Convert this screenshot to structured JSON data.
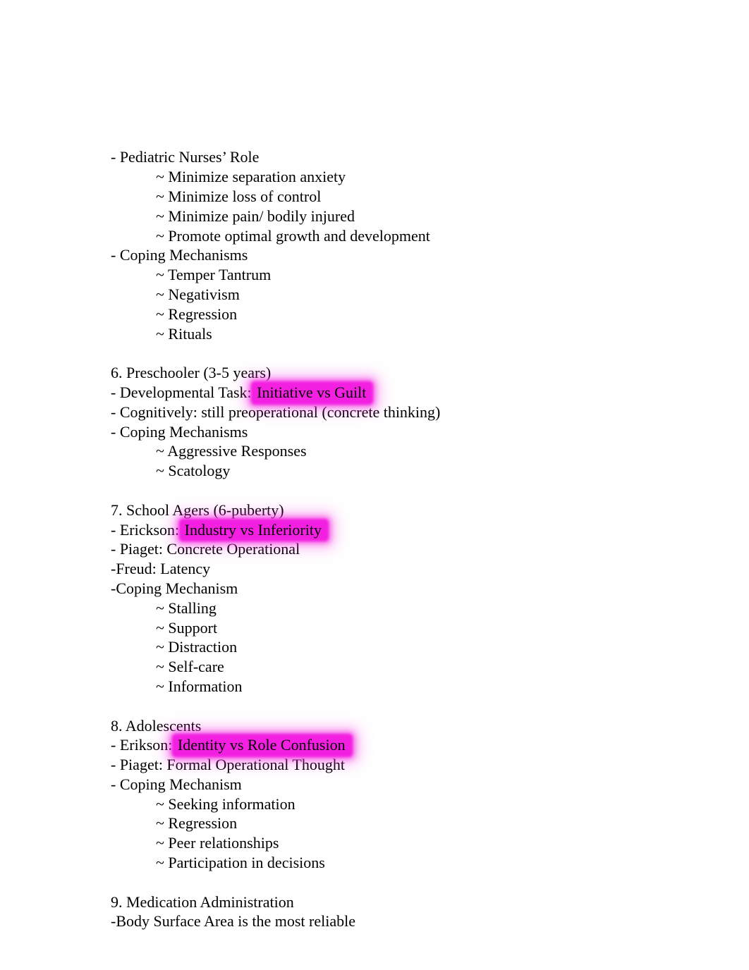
{
  "page": {
    "background_color": "#ffffff",
    "text_color": "#000000",
    "highlight_color": "#f320e2"
  },
  "document": {
    "blocks": [
      {
        "id": "block-pediatric-nurses-role",
        "lines": [
          {
            "id": "line-1",
            "indent": 0,
            "text": "- Pediatric Nurses’ Role"
          },
          {
            "id": "line-2",
            "indent": 1,
            "text": "~ Minimize separation anxiety"
          },
          {
            "id": "line-3",
            "indent": 1,
            "text": "~ Minimize loss of control"
          },
          {
            "id": "line-4",
            "indent": 1,
            "text": "~ Minimize pain/ bodily injured"
          },
          {
            "id": "line-5",
            "indent": 1,
            "text": "~ Promote optimal growth and development"
          },
          {
            "id": "line-6",
            "indent": 0,
            "text": "- Coping Mechanisms"
          },
          {
            "id": "line-7",
            "indent": 1,
            "text": "~ Temper Tantrum"
          },
          {
            "id": "line-8",
            "indent": 1,
            "text": "~ Negativism"
          },
          {
            "id": "line-9",
            "indent": 1,
            "text": "~ Regression"
          },
          {
            "id": "line-10",
            "indent": 1,
            "text": "~ Rituals"
          }
        ]
      },
      {
        "id": "block-preschooler",
        "lines": [
          {
            "id": "line-11",
            "indent": 0,
            "text": "6. Preschooler (3-5 years)"
          },
          {
            "id": "line-12",
            "indent": 0,
            "prefix": "- Developmental Task: ",
            "highlight": "Initiative vs Guilt",
            "suffix": ""
          },
          {
            "id": "line-13",
            "indent": 0,
            "text": "- Cognitively: still preoperational (concrete thinking)"
          },
          {
            "id": "line-14",
            "indent": 0,
            "text": "- Coping Mechanisms"
          },
          {
            "id": "line-15",
            "indent": 1,
            "text": "~ Aggressive Responses"
          },
          {
            "id": "line-16",
            "indent": 1,
            "text": "~ Scatology"
          }
        ]
      },
      {
        "id": "block-school-agers",
        "lines": [
          {
            "id": "line-17",
            "indent": 0,
            "text": "7. School Agers (6-puberty)"
          },
          {
            "id": "line-18",
            "indent": 0,
            "prefix": "- Erickson: ",
            "highlight": "Industry vs Inferiority",
            "suffix": ""
          },
          {
            "id": "line-19",
            "indent": 0,
            "text": "- Piaget: Concrete Operational"
          },
          {
            "id": "line-20",
            "indent": 0,
            "text": "-Freud: Latency"
          },
          {
            "id": "line-21",
            "indent": 0,
            "text": "-Coping Mechanism"
          },
          {
            "id": "line-22",
            "indent": 1,
            "text": "~ Stalling"
          },
          {
            "id": "line-23",
            "indent": 1,
            "text": "~ Support"
          },
          {
            "id": "line-24",
            "indent": 1,
            "text": "~ Distraction"
          },
          {
            "id": "line-25",
            "indent": 1,
            "text": "~ Self-care"
          },
          {
            "id": "line-26",
            "indent": 1,
            "text": "~ Information"
          }
        ]
      },
      {
        "id": "block-adolescents",
        "lines": [
          {
            "id": "line-27",
            "indent": 0,
            "text": "8. Adolescents"
          },
          {
            "id": "line-28",
            "indent": 0,
            "prefix": "- Erikson: ",
            "highlight": "Identity vs Role Confusion",
            "suffix": ""
          },
          {
            "id": "line-29",
            "indent": 0,
            "text": "- Piaget: Formal Operational Thought"
          },
          {
            "id": "line-30",
            "indent": 0,
            "text": "- Coping Mechanism"
          },
          {
            "id": "line-31",
            "indent": 1,
            "text": "~ Seeking information"
          },
          {
            "id": "line-32",
            "indent": 1,
            "text": "~ Regression"
          },
          {
            "id": "line-33",
            "indent": 1,
            "text": "~ Peer relationships"
          },
          {
            "id": "line-34",
            "indent": 1,
            "text": "~ Participation in decisions"
          }
        ]
      },
      {
        "id": "block-medication-administration",
        "lines": [
          {
            "id": "line-35",
            "indent": 0,
            "text": "9. Medication Administration"
          },
          {
            "id": "line-36",
            "indent": 0,
            "text": "-Body Surface Area is the most reliable"
          }
        ]
      }
    ]
  }
}
